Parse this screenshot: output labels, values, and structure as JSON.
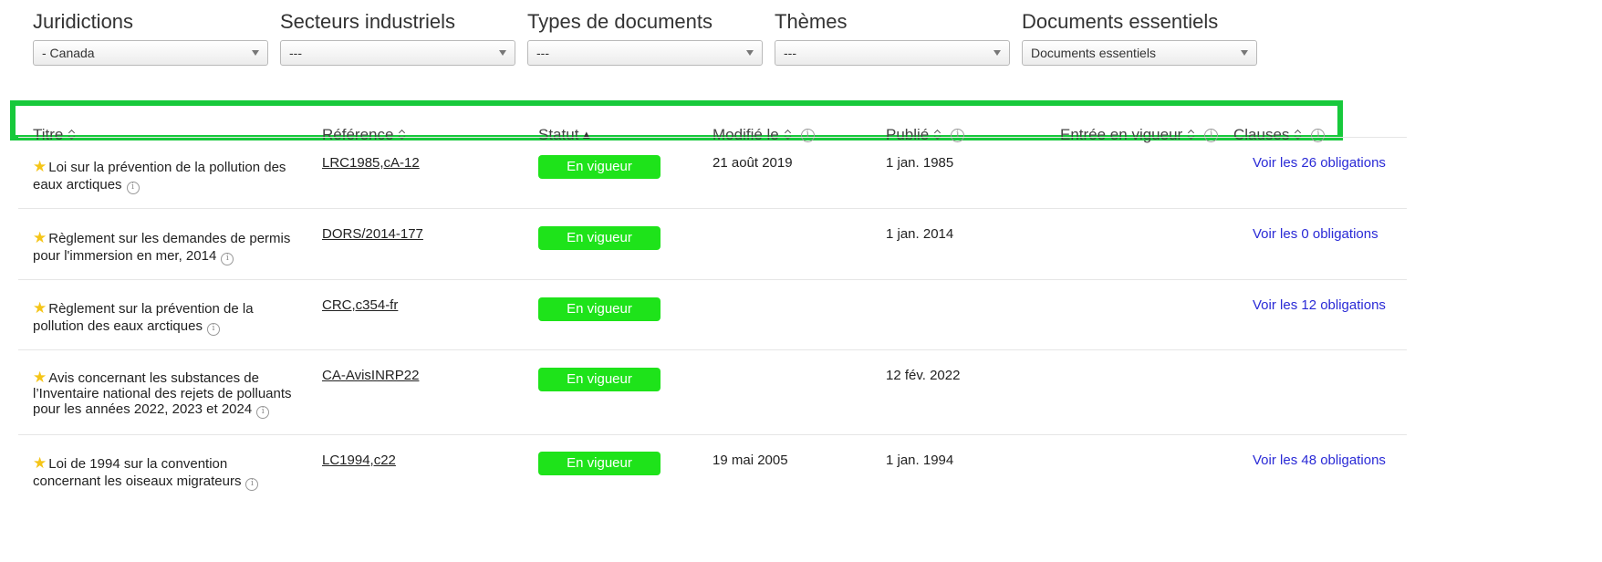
{
  "filters": [
    {
      "label": "Juridictions",
      "value": "- Canada"
    },
    {
      "label": "Secteurs industriels",
      "value": "---"
    },
    {
      "label": "Types de documents",
      "value": "---"
    },
    {
      "label": "Thèmes",
      "value": "---"
    },
    {
      "label": "Documents essentiels",
      "value": "Documents essentiels"
    }
  ],
  "columns": {
    "title": "Titre",
    "reference": "Référence",
    "status": "Statut",
    "status_sort": "▲",
    "modified": "Modifié le",
    "published": "Publié",
    "effective": "Entrée en vigueur",
    "clauses": "Clauses",
    "info_glyph": "i"
  },
  "colors": {
    "highlight": "#17c93b",
    "badge": "#1ee31a",
    "link": "#2a2ad6",
    "star": "#f5c518"
  },
  "rows": [
    {
      "title_line1": "Loi sur la prévention de la pollution des",
      "title_line2": "eaux arctiques",
      "title_line3": "",
      "reference": "LRC1985,cA-12",
      "status": "En vigueur",
      "modified": "21 août 2019",
      "published": "1 jan. 1985",
      "effective": "",
      "clauses": "Voir les 26 obligations"
    },
    {
      "title_line1": "Règlement sur les demandes de permis",
      "title_line2": "pour l'immersion en mer, 2014",
      "title_line3": "",
      "reference": "DORS/2014-177",
      "status": "En vigueur",
      "modified": "",
      "published": "1 jan. 2014",
      "effective": "",
      "clauses": "Voir les 0 obligations"
    },
    {
      "title_line1": "Règlement sur la prévention de la",
      "title_line2": "pollution des eaux arctiques",
      "title_line3": "",
      "reference": "CRC,c354-fr",
      "status": "En vigueur",
      "modified": "",
      "published": "",
      "effective": "",
      "clauses": "Voir les 12 obligations"
    },
    {
      "title_line1": "Avis concernant les substances de",
      "title_line2": "l’Inventaire national des rejets de polluants",
      "title_line3": "pour les années 2022, 2023 et 2024",
      "reference": "CA-AvisINRP22",
      "status": "En vigueur",
      "modified": "",
      "published": "12 fév. 2022",
      "effective": "",
      "clauses": ""
    },
    {
      "title_line1": "Loi de 1994 sur la convention",
      "title_line2": "concernant les oiseaux migrateurs",
      "title_line3": "",
      "reference": "LC1994,c22",
      "status": "En vigueur",
      "modified": "19 mai 2005",
      "published": "1 jan. 1994",
      "effective": "",
      "clauses": "Voir les 48 obligations"
    }
  ]
}
